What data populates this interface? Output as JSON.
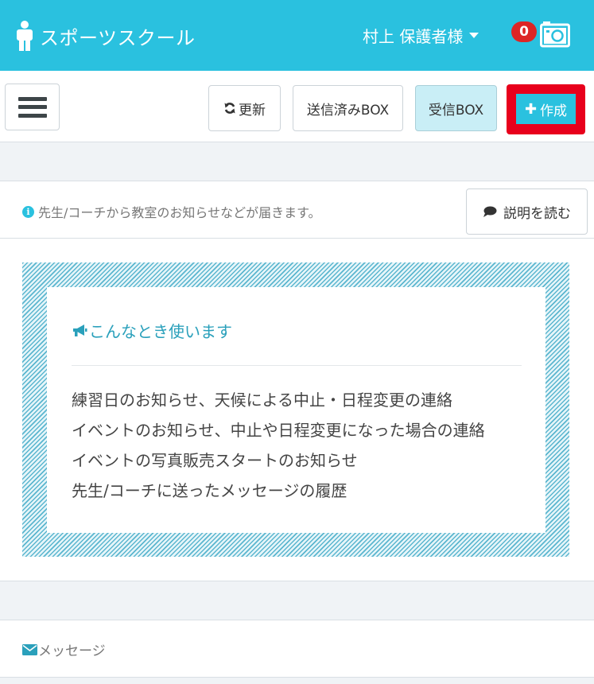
{
  "header": {
    "app_title": "スポーツスクール",
    "user_name": "村上 保護者様",
    "notification_count": "0",
    "icons": {
      "brand": "person-icon",
      "camera": "camera-icon"
    },
    "colors": {
      "header_bg": "#2ac1df",
      "badge": "#dd2525"
    }
  },
  "toolbar": {
    "menu_icon": "hamburger-icon",
    "refresh_label": "更新",
    "sent_label": "送信済みBOX",
    "inbox_label": "受信BOX",
    "create_label": "作成",
    "colors": {
      "create_highlight": "#e8001c",
      "inbox_active_bg": "#c9eef6"
    }
  },
  "info": {
    "notice": "先生/コーチから教室のお知らせなどが届きます。",
    "read_button_label": "説明を読む",
    "usage_title": "こんなとき使います",
    "usage_items": [
      "練習日のお知らせ、天候による中止・日程変更の連絡",
      "イベントのお知らせ、中止や日程変更になった場合の連絡",
      "イベントの写真販売スタートのお知らせ",
      "先生/コーチに送ったメッセージの履歴"
    ]
  },
  "messages": {
    "section_label": "メッセージ"
  }
}
